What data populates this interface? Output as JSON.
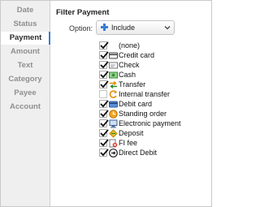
{
  "sidebar": {
    "items": [
      {
        "label": "Date",
        "active": false
      },
      {
        "label": "Status",
        "active": false
      },
      {
        "label": "Payment",
        "active": true
      },
      {
        "label": "Amount",
        "active": false
      },
      {
        "label": "Text",
        "active": false
      },
      {
        "label": "Category",
        "active": false
      },
      {
        "label": "Payee",
        "active": false
      },
      {
        "label": "Account",
        "active": false
      }
    ]
  },
  "main": {
    "title": "Filter Payment",
    "option_label": "Option:",
    "option_value": "Include",
    "option_icon": "plus-icon",
    "payments": [
      {
        "label": "(none)",
        "checked": true,
        "icon": "none"
      },
      {
        "label": "Credit card",
        "checked": true,
        "icon": "credit-card-icon"
      },
      {
        "label": "Check",
        "checked": true,
        "icon": "check-icon"
      },
      {
        "label": "Cash",
        "checked": true,
        "icon": "cash-icon"
      },
      {
        "label": "Transfer",
        "checked": true,
        "icon": "transfer-icon"
      },
      {
        "label": "Internal transfer",
        "checked": false,
        "icon": "internal-transfer-icon"
      },
      {
        "label": "Debit card",
        "checked": true,
        "icon": "debit-card-icon"
      },
      {
        "label": "Standing order",
        "checked": true,
        "icon": "standing-order-icon"
      },
      {
        "label": "Electronic payment",
        "checked": true,
        "icon": "electronic-payment-icon"
      },
      {
        "label": "Deposit",
        "checked": true,
        "icon": "deposit-icon"
      },
      {
        "label": "FI fee",
        "checked": true,
        "icon": "fi-fee-icon"
      },
      {
        "label": "Direct Debit",
        "checked": true,
        "icon": "direct-debit-icon"
      }
    ]
  },
  "colors": {
    "accent": "#3a7bd5",
    "sidebar_bg": "#efefef",
    "sidebar_text": "#8f8f8f"
  }
}
